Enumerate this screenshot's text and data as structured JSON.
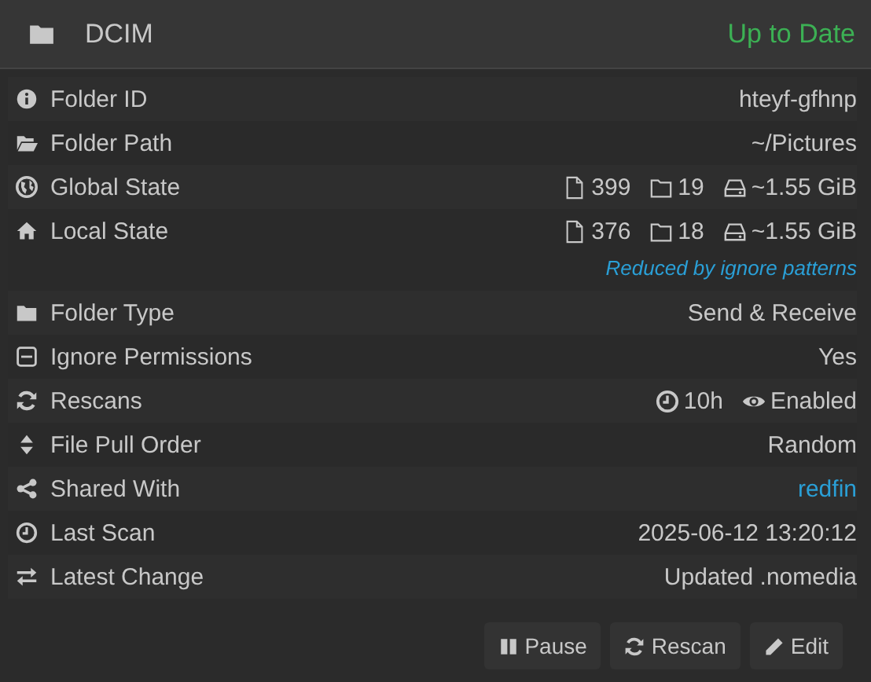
{
  "header": {
    "title": "DCIM",
    "status": "Up to Date"
  },
  "rows": [
    {
      "kind": "text",
      "label": "Folder ID",
      "value": "hteyf-gfhnp"
    },
    {
      "kind": "text",
      "label": "Folder Path",
      "value": "~/Pictures"
    },
    {
      "kind": "stats",
      "label": "Global State",
      "files": "399",
      "folders": "19",
      "size": "~1.55 GiB"
    },
    {
      "kind": "stats",
      "label": "Local State",
      "files": "376",
      "folders": "18",
      "size": "~1.55 GiB",
      "note": "Reduced by ignore patterns"
    },
    {
      "kind": "text",
      "label": "Folder Type",
      "value": "Send & Receive"
    },
    {
      "kind": "text",
      "label": "Ignore Permissions",
      "value": "Yes"
    },
    {
      "kind": "rescans",
      "label": "Rescans",
      "interval": "10h",
      "watcher": "Enabled"
    },
    {
      "kind": "text",
      "label": "File Pull Order",
      "value": "Random"
    },
    {
      "kind": "link",
      "label": "Shared With",
      "value": "redfin"
    },
    {
      "kind": "text",
      "label": "Last Scan",
      "value": "2025-06-12 13:20:12"
    },
    {
      "kind": "text",
      "label": "Latest Change",
      "value": "Updated .nomedia"
    }
  ],
  "buttons": [
    "Pause",
    "Rescan",
    "Edit"
  ]
}
